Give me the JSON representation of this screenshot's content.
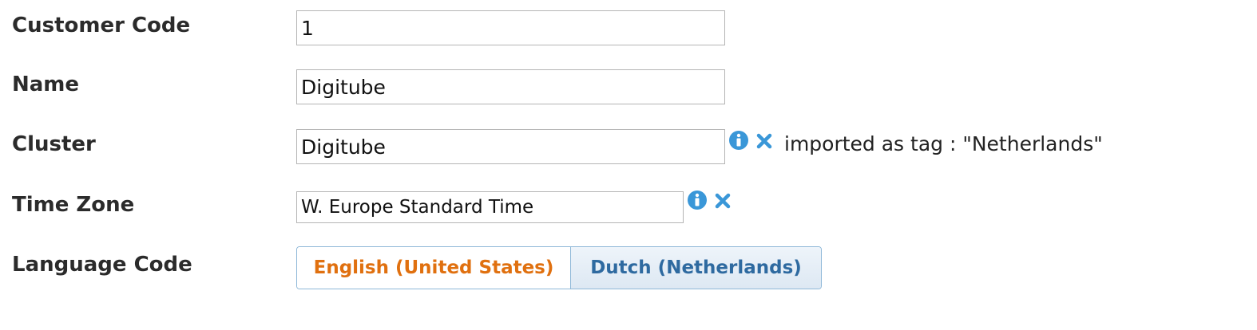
{
  "form": {
    "customer_code": {
      "label": "Customer Code",
      "value": "1"
    },
    "name": {
      "label": "Name",
      "value": "Digitube"
    },
    "cluster": {
      "label": "Cluster",
      "value": "Digitube",
      "note": "imported as tag : \"Netherlands\"",
      "icons": [
        "info-icon",
        "clear-icon"
      ]
    },
    "time_zone": {
      "label": "Time Zone",
      "value": "W. Europe Standard Time",
      "icons": [
        "info-icon",
        "clear-icon"
      ]
    },
    "language_code": {
      "label": "Language Code",
      "options": [
        "English (United States)",
        "Dutch (Netherlands)"
      ],
      "selected": "Dutch (Netherlands)"
    }
  },
  "colors": {
    "icon_blue": "#3a97d8",
    "option_orange": "#e0700f",
    "option_blue": "#2e6aa0",
    "toggle_border": "#8fb8d8"
  }
}
